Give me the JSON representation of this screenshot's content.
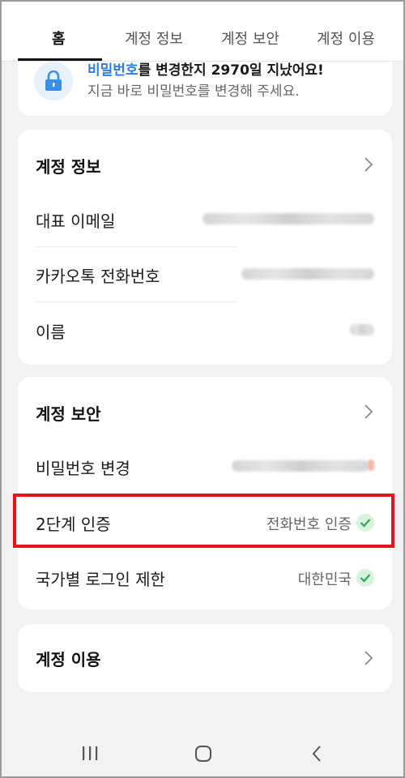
{
  "tabs": [
    {
      "label": "홈",
      "active": true
    },
    {
      "label": "계정 정보",
      "active": false
    },
    {
      "label": "계정 보안",
      "active": false
    },
    {
      "label": "계정 이용",
      "active": false
    }
  ],
  "notice": {
    "title_highlight": "비밀번호",
    "title_rest": "를 변경한지 2970일 지났어요!",
    "subtitle": "지금 바로 비밀번호를 변경해 주세요."
  },
  "account_info": {
    "title": "계정 정보",
    "rows": [
      {
        "label": "대표 이메일"
      },
      {
        "label": "카카오톡 전화번호"
      },
      {
        "label": "이름"
      }
    ]
  },
  "account_security": {
    "title": "계정 보안",
    "rows": [
      {
        "label": "비밀번호 변경"
      },
      {
        "label": "2단계 인증",
        "value": "전화번호 인증"
      },
      {
        "label": "국가별 로그인 제한",
        "value": "대한민국"
      }
    ]
  },
  "account_usage": {
    "title": "계정 이용"
  },
  "colors": {
    "accent": "#2f7de1",
    "highlight_border": "#e8141a",
    "check_bg": "#d8f2dd",
    "check_mark": "#2fa84f"
  },
  "icons": [
    "lock-icon",
    "chevron-right-icon",
    "check-icon",
    "recent-apps-icon",
    "home-icon",
    "back-icon"
  ]
}
